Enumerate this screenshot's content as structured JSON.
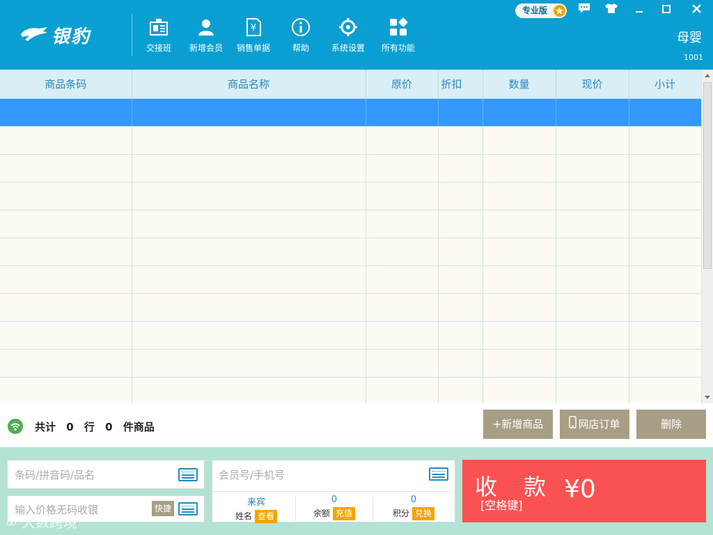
{
  "header": {
    "brand": "银豹",
    "nav": [
      {
        "label": "交接班",
        "icon": "shift-handover-icon"
      },
      {
        "label": "新增会员",
        "icon": "add-member-icon"
      },
      {
        "label": "销售单据",
        "icon": "sales-receipt-icon"
      },
      {
        "label": "帮助",
        "icon": "help-icon"
      },
      {
        "label": "系统设置",
        "icon": "settings-icon"
      },
      {
        "label": "所有功能",
        "icon": "all-functions-icon"
      }
    ],
    "edition": "专业版",
    "store_name": "母婴",
    "store_id": "1001"
  },
  "table": {
    "columns": [
      "商品条码",
      "商品名称",
      "原价",
      "折扣",
      "数量",
      "现价",
      "小计"
    ],
    "row_count": 11,
    "selected_row": 0
  },
  "summary": {
    "prefix": "共计",
    "rows": "0",
    "rows_unit": "行",
    "items": "0",
    "items_unit": "件商品"
  },
  "actions": {
    "add_product": "新增商品",
    "online_order": "网店订单",
    "delete": "删除"
  },
  "inputs": {
    "barcode_placeholder": "条码/拼音码/品名",
    "price_placeholder": "输入价格无码收银",
    "quick_label": "快捷",
    "member_placeholder": "会员号/手机号"
  },
  "member": {
    "name_value": "来宾",
    "name_label": "姓名",
    "view_button": "查看",
    "balance_value": "0",
    "balance_label": "余额",
    "recharge_button": "充值",
    "points_value": "0",
    "points_label": "积分",
    "redeem_button": "兑换"
  },
  "payment": {
    "label": "收 款",
    "hint": "[空格键]",
    "amount": "¥0"
  },
  "watermark": "大数跨境",
  "colors": {
    "header_bg": "#0a9fd2",
    "selected_row": "#3399ff",
    "pay_bg": "#fa5252",
    "action_btn": "#a79f85",
    "badge_orange": "#f5a400",
    "bottom_bg": "#b2e3d4"
  }
}
